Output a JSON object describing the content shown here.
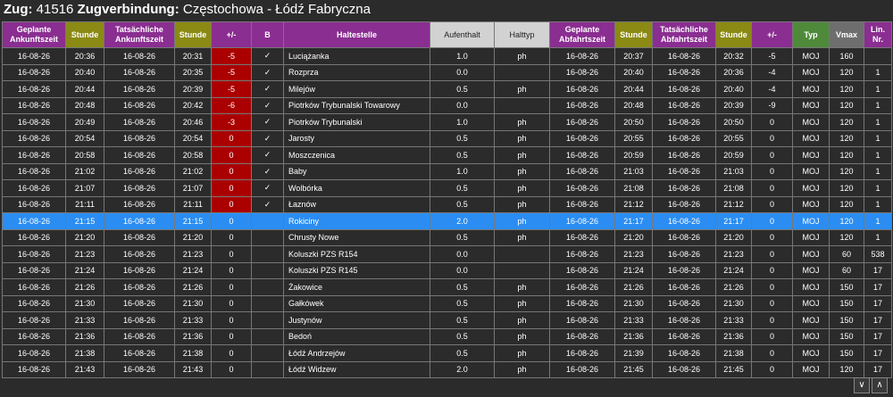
{
  "header": {
    "train_label": "Zug:",
    "train_number": "41516",
    "connection_label": "Zugverbindung:",
    "connection": "Częstochowa - Łódź Fabryczna"
  },
  "columns": [
    {
      "label": "Geplante Ankunftszeit",
      "color": "purple"
    },
    {
      "label": "Stunde",
      "color": "olive"
    },
    {
      "label": "Tatsächliche Ankunftszeit",
      "color": "purple"
    },
    {
      "label": "Stunde",
      "color": "olive"
    },
    {
      "label": "+/-",
      "color": "purple"
    },
    {
      "label": "B",
      "color": "purple"
    },
    {
      "label": "Haltestelle",
      "color": "purple"
    },
    {
      "label": "Aufenthalt",
      "color": "grey"
    },
    {
      "label": "Halttyp",
      "color": "grey"
    },
    {
      "label": "Geplante Abfahrtszeit",
      "color": "purple"
    },
    {
      "label": "Stunde",
      "color": "olive"
    },
    {
      "label": "Tatsächliche Abfahrtszeit",
      "color": "purple"
    },
    {
      "label": "Stunde",
      "color": "olive"
    },
    {
      "label": "+/-",
      "color": "purple"
    },
    {
      "label": "Typ",
      "color": "green"
    },
    {
      "label": "Vmax",
      "color": "dgrey"
    },
    {
      "label": "Lin. Nr.",
      "color": "purple"
    }
  ],
  "rows": [
    {
      "pd": "16-08-26",
      "ph": "20:36",
      "ad": "16-08-26",
      "ah": "20:31",
      "delay": "-5",
      "delay_red": true,
      "b": "✓",
      "stop": "Luciążanka",
      "stay": "1.0",
      "type": "ph",
      "dpd": "16-08-26",
      "dph": "20:37",
      "dad": "16-08-26",
      "dah": "20:32",
      "ddelay": "-5",
      "typ": "MOJ",
      "vmax": "160",
      "line": "",
      "sel": false
    },
    {
      "pd": "16-08-26",
      "ph": "20:40",
      "ad": "16-08-26",
      "ah": "20:35",
      "delay": "-5",
      "delay_red": true,
      "b": "✓",
      "stop": "Rozprza",
      "stay": "0.0",
      "type": "",
      "dpd": "16-08-26",
      "dph": "20:40",
      "dad": "16-08-26",
      "dah": "20:36",
      "ddelay": "-4",
      "typ": "MOJ",
      "vmax": "120",
      "line": "1",
      "sel": false
    },
    {
      "pd": "16-08-26",
      "ph": "20:44",
      "ad": "16-08-26",
      "ah": "20:39",
      "delay": "-5",
      "delay_red": true,
      "b": "✓",
      "stop": "Milejów",
      "stay": "0.5",
      "type": "ph",
      "dpd": "16-08-26",
      "dph": "20:44",
      "dad": "16-08-26",
      "dah": "20:40",
      "ddelay": "-4",
      "typ": "MOJ",
      "vmax": "120",
      "line": "1",
      "sel": false
    },
    {
      "pd": "16-08-26",
      "ph": "20:48",
      "ad": "16-08-26",
      "ah": "20:42",
      "delay": "-6",
      "delay_red": true,
      "b": "✓",
      "stop": "Piotrków Trybunalski Towarowy",
      "stay": "0.0",
      "type": "",
      "dpd": "16-08-26",
      "dph": "20:48",
      "dad": "16-08-26",
      "dah": "20:39",
      "ddelay": "-9",
      "typ": "MOJ",
      "vmax": "120",
      "line": "1",
      "sel": false
    },
    {
      "pd": "16-08-26",
      "ph": "20:49",
      "ad": "16-08-26",
      "ah": "20:46",
      "delay": "-3",
      "delay_red": true,
      "b": "✓",
      "stop": "Piotrków Trybunalski",
      "stay": "1.0",
      "type": "ph",
      "dpd": "16-08-26",
      "dph": "20:50",
      "dad": "16-08-26",
      "dah": "20:50",
      "ddelay": "0",
      "typ": "MOJ",
      "vmax": "120",
      "line": "1",
      "sel": false
    },
    {
      "pd": "16-08-26",
      "ph": "20:54",
      "ad": "16-08-26",
      "ah": "20:54",
      "delay": "0",
      "delay_red": true,
      "b": "✓",
      "stop": "Jarosty",
      "stay": "0.5",
      "type": "ph",
      "dpd": "16-08-26",
      "dph": "20:55",
      "dad": "16-08-26",
      "dah": "20:55",
      "ddelay": "0",
      "typ": "MOJ",
      "vmax": "120",
      "line": "1",
      "sel": false
    },
    {
      "pd": "16-08-26",
      "ph": "20:58",
      "ad": "16-08-26",
      "ah": "20:58",
      "delay": "0",
      "delay_red": true,
      "b": "✓",
      "stop": "Moszczenica",
      "stay": "0.5",
      "type": "ph",
      "dpd": "16-08-26",
      "dph": "20:59",
      "dad": "16-08-26",
      "dah": "20:59",
      "ddelay": "0",
      "typ": "MOJ",
      "vmax": "120",
      "line": "1",
      "sel": false
    },
    {
      "pd": "16-08-26",
      "ph": "21:02",
      "ad": "16-08-26",
      "ah": "21:02",
      "delay": "0",
      "delay_red": true,
      "b": "✓",
      "stop": "Baby",
      "stay": "1.0",
      "type": "ph",
      "dpd": "16-08-26",
      "dph": "21:03",
      "dad": "16-08-26",
      "dah": "21:03",
      "ddelay": "0",
      "typ": "MOJ",
      "vmax": "120",
      "line": "1",
      "sel": false
    },
    {
      "pd": "16-08-26",
      "ph": "21:07",
      "ad": "16-08-26",
      "ah": "21:07",
      "delay": "0",
      "delay_red": true,
      "b": "✓",
      "stop": "Wolbórka",
      "stay": "0.5",
      "type": "ph",
      "dpd": "16-08-26",
      "dph": "21:08",
      "dad": "16-08-26",
      "dah": "21:08",
      "ddelay": "0",
      "typ": "MOJ",
      "vmax": "120",
      "line": "1",
      "sel": false
    },
    {
      "pd": "16-08-26",
      "ph": "21:11",
      "ad": "16-08-26",
      "ah": "21:11",
      "delay": "0",
      "delay_red": true,
      "b": "✓",
      "stop": "Łaznów",
      "stay": "0.5",
      "type": "ph",
      "dpd": "16-08-26",
      "dph": "21:12",
      "dad": "16-08-26",
      "dah": "21:12",
      "ddelay": "0",
      "typ": "MOJ",
      "vmax": "120",
      "line": "1",
      "sel": false
    },
    {
      "pd": "16-08-26",
      "ph": "21:15",
      "ad": "16-08-26",
      "ah": "21:15",
      "delay": "0",
      "delay_red": false,
      "b": "",
      "stop": "Rokiciny",
      "stay": "2.0",
      "type": "ph",
      "dpd": "16-08-26",
      "dph": "21:17",
      "dad": "16-08-26",
      "dah": "21:17",
      "ddelay": "0",
      "typ": "MOJ",
      "vmax": "120",
      "line": "1",
      "sel": true
    },
    {
      "pd": "16-08-26",
      "ph": "21:20",
      "ad": "16-08-26",
      "ah": "21:20",
      "delay": "0",
      "delay_red": false,
      "b": "",
      "stop": "Chrusty Nowe",
      "stay": "0.5",
      "type": "ph",
      "dpd": "16-08-26",
      "dph": "21:20",
      "dad": "16-08-26",
      "dah": "21:20",
      "ddelay": "0",
      "typ": "MOJ",
      "vmax": "120",
      "line": "1",
      "sel": false
    },
    {
      "pd": "16-08-26",
      "ph": "21:23",
      "ad": "16-08-26",
      "ah": "21:23",
      "delay": "0",
      "delay_red": false,
      "b": "",
      "stop": "Koluszki PZS R154",
      "stay": "0.0",
      "type": "",
      "dpd": "16-08-26",
      "dph": "21:23",
      "dad": "16-08-26",
      "dah": "21:23",
      "ddelay": "0",
      "typ": "MOJ",
      "vmax": "60",
      "line": "538",
      "sel": false
    },
    {
      "pd": "16-08-26",
      "ph": "21:24",
      "ad": "16-08-26",
      "ah": "21:24",
      "delay": "0",
      "delay_red": false,
      "b": "",
      "stop": "Koluszki PZS R145",
      "stay": "0.0",
      "type": "",
      "dpd": "16-08-26",
      "dph": "21:24",
      "dad": "16-08-26",
      "dah": "21:24",
      "ddelay": "0",
      "typ": "MOJ",
      "vmax": "60",
      "line": "17",
      "sel": false
    },
    {
      "pd": "16-08-26",
      "ph": "21:26",
      "ad": "16-08-26",
      "ah": "21:26",
      "delay": "0",
      "delay_red": false,
      "b": "",
      "stop": "Żakowice",
      "stay": "0.5",
      "type": "ph",
      "dpd": "16-08-26",
      "dph": "21:26",
      "dad": "16-08-26",
      "dah": "21:26",
      "ddelay": "0",
      "typ": "MOJ",
      "vmax": "150",
      "line": "17",
      "sel": false
    },
    {
      "pd": "16-08-26",
      "ph": "21:30",
      "ad": "16-08-26",
      "ah": "21:30",
      "delay": "0",
      "delay_red": false,
      "b": "",
      "stop": "Gałkówek",
      "stay": "0.5",
      "type": "ph",
      "dpd": "16-08-26",
      "dph": "21:30",
      "dad": "16-08-26",
      "dah": "21:30",
      "ddelay": "0",
      "typ": "MOJ",
      "vmax": "150",
      "line": "17",
      "sel": false
    },
    {
      "pd": "16-08-26",
      "ph": "21:33",
      "ad": "16-08-26",
      "ah": "21:33",
      "delay": "0",
      "delay_red": false,
      "b": "",
      "stop": "Justynów",
      "stay": "0.5",
      "type": "ph",
      "dpd": "16-08-26",
      "dph": "21:33",
      "dad": "16-08-26",
      "dah": "21:33",
      "ddelay": "0",
      "typ": "MOJ",
      "vmax": "150",
      "line": "17",
      "sel": false
    },
    {
      "pd": "16-08-26",
      "ph": "21:36",
      "ad": "16-08-26",
      "ah": "21:36",
      "delay": "0",
      "delay_red": false,
      "b": "",
      "stop": "Bedoń",
      "stay": "0.5",
      "type": "ph",
      "dpd": "16-08-26",
      "dph": "21:36",
      "dad": "16-08-26",
      "dah": "21:36",
      "ddelay": "0",
      "typ": "MOJ",
      "vmax": "150",
      "line": "17",
      "sel": false
    },
    {
      "pd": "16-08-26",
      "ph": "21:38",
      "ad": "16-08-26",
      "ah": "21:38",
      "delay": "0",
      "delay_red": false,
      "b": "",
      "stop": "Łódź Andrzejów",
      "stay": "0.5",
      "type": "ph",
      "dpd": "16-08-26",
      "dph": "21:39",
      "dad": "16-08-26",
      "dah": "21:38",
      "ddelay": "0",
      "typ": "MOJ",
      "vmax": "150",
      "line": "17",
      "sel": false
    },
    {
      "pd": "16-08-26",
      "ph": "21:43",
      "ad": "16-08-26",
      "ah": "21:43",
      "delay": "0",
      "delay_red": false,
      "b": "",
      "stop": "Łódź Widzew",
      "stay": "2.0",
      "type": "ph",
      "dpd": "16-08-26",
      "dph": "21:45",
      "dad": "16-08-26",
      "dah": "21:45",
      "ddelay": "0",
      "typ": "MOJ",
      "vmax": "120",
      "line": "17",
      "sel": false
    }
  ],
  "scroll": {
    "down": "∨",
    "up": "∧"
  }
}
